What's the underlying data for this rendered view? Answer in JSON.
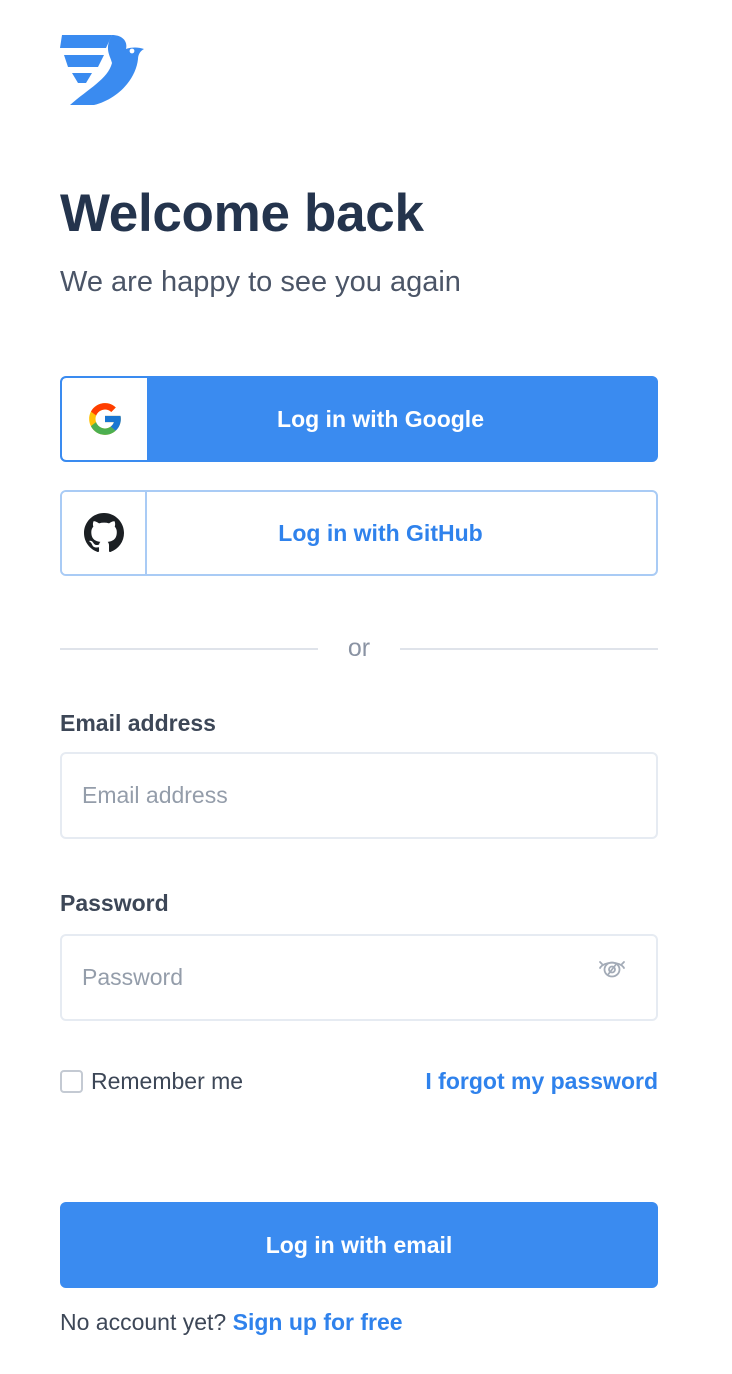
{
  "brand": {
    "logo_icon": "bird-logo-icon",
    "accent_color": "#3a8bf0"
  },
  "header": {
    "title": "Welcome back",
    "subtitle": "We are happy to see you again"
  },
  "social": {
    "google": {
      "label": "Log in with Google",
      "icon": "google-icon"
    },
    "github": {
      "label": "Log in with GitHub",
      "icon": "github-icon"
    }
  },
  "divider": {
    "text": "or"
  },
  "form": {
    "email": {
      "label": "Email address",
      "placeholder": "Email address",
      "value": ""
    },
    "password": {
      "label": "Password",
      "placeholder": "Password",
      "value": "",
      "toggle_icon": "eye-icon"
    },
    "remember": {
      "label": "Remember me",
      "checked": false
    },
    "forgot_label": "I forgot my password",
    "submit_label": "Log in with email"
  },
  "footer": {
    "prompt": "No account yet?",
    "signup_label": "Sign up for free"
  }
}
